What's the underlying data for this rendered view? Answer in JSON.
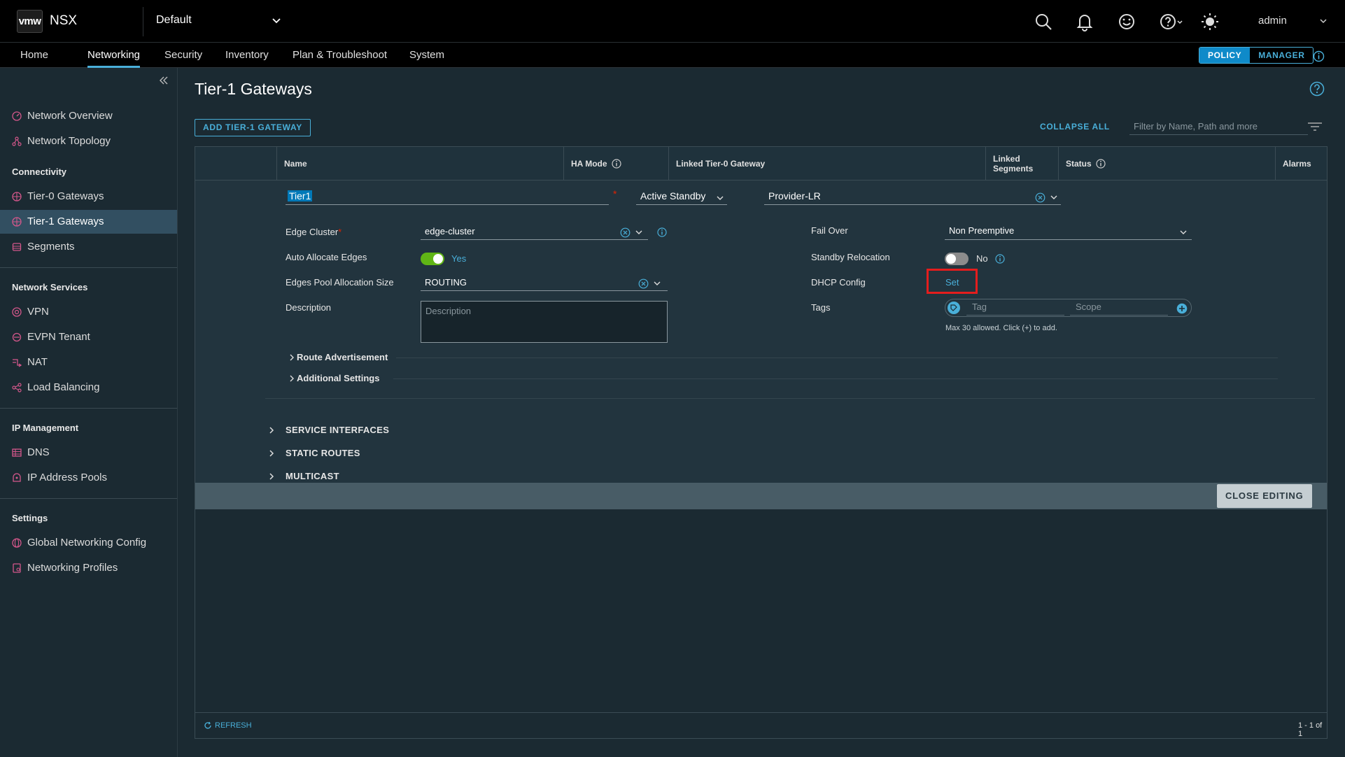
{
  "header": {
    "logo": "vmw",
    "product": "NSX",
    "context": "Default",
    "user": "admin"
  },
  "nav": {
    "tabs": [
      "Home",
      "Networking",
      "Security",
      "Inventory",
      "Plan & Troubleshoot",
      "System"
    ],
    "mode_policy": "POLICY",
    "mode_manager": "MANAGER"
  },
  "sidebar": {
    "items": [
      {
        "label": "Network Overview"
      },
      {
        "label": "Network Topology"
      }
    ],
    "sections": [
      {
        "title": "Connectivity",
        "items": [
          "Tier-0 Gateways",
          "Tier-1 Gateways",
          "Segments"
        ]
      },
      {
        "title": "Network Services",
        "items": [
          "VPN",
          "EVPN Tenant",
          "NAT",
          "Load Balancing"
        ]
      },
      {
        "title": "IP Management",
        "items": [
          "DNS",
          "IP Address Pools"
        ]
      },
      {
        "title": "Settings",
        "items": [
          "Global Networking Config",
          "Networking Profiles"
        ]
      }
    ]
  },
  "main": {
    "title": "Tier-1 Gateways",
    "add_button": "ADD TIER-1 GATEWAY",
    "collapse_all": "COLLAPSE ALL",
    "filter_placeholder": "Filter by Name, Path and more",
    "columns": [
      "Name",
      "HA Mode",
      "Linked Tier-0 Gateway",
      "Linked Segments",
      "Status",
      "Alarms"
    ],
    "row": {
      "name": "Tier1",
      "ha_mode": "Active Standby",
      "linked_t0": "Provider-LR"
    },
    "form": {
      "edge_cluster_label": "Edge Cluster",
      "edge_cluster_value": "edge-cluster",
      "auto_alloc_label": "Auto Allocate Edges",
      "auto_alloc_value": "Yes",
      "pool_size_label": "Edges Pool Allocation Size",
      "pool_size_value": "ROUTING",
      "description_label": "Description",
      "description_placeholder": "Description",
      "failover_label": "Fail Over",
      "failover_value": "Non Preemptive",
      "standby_label": "Standby Relocation",
      "standby_value": "No",
      "dhcp_label": "DHCP Config",
      "dhcp_link": "Set",
      "tags_label": "Tags",
      "tag_placeholder": "Tag",
      "scope_placeholder": "Scope",
      "tags_hint": "Max 30 allowed. Click (+) to add.",
      "route_adv": "Route Advertisement",
      "additional": "Additional Settings"
    },
    "sections": [
      "SERVICE INTERFACES",
      "STATIC ROUTES",
      "MULTICAST"
    ],
    "close_editing": "CLOSE EDITING",
    "refresh": "REFRESH",
    "pager": "1 - 1 of 1"
  },
  "colors": {
    "accent": "#49afd9",
    "highlight": "#e41d1d",
    "toggle_on": "#60b515"
  }
}
